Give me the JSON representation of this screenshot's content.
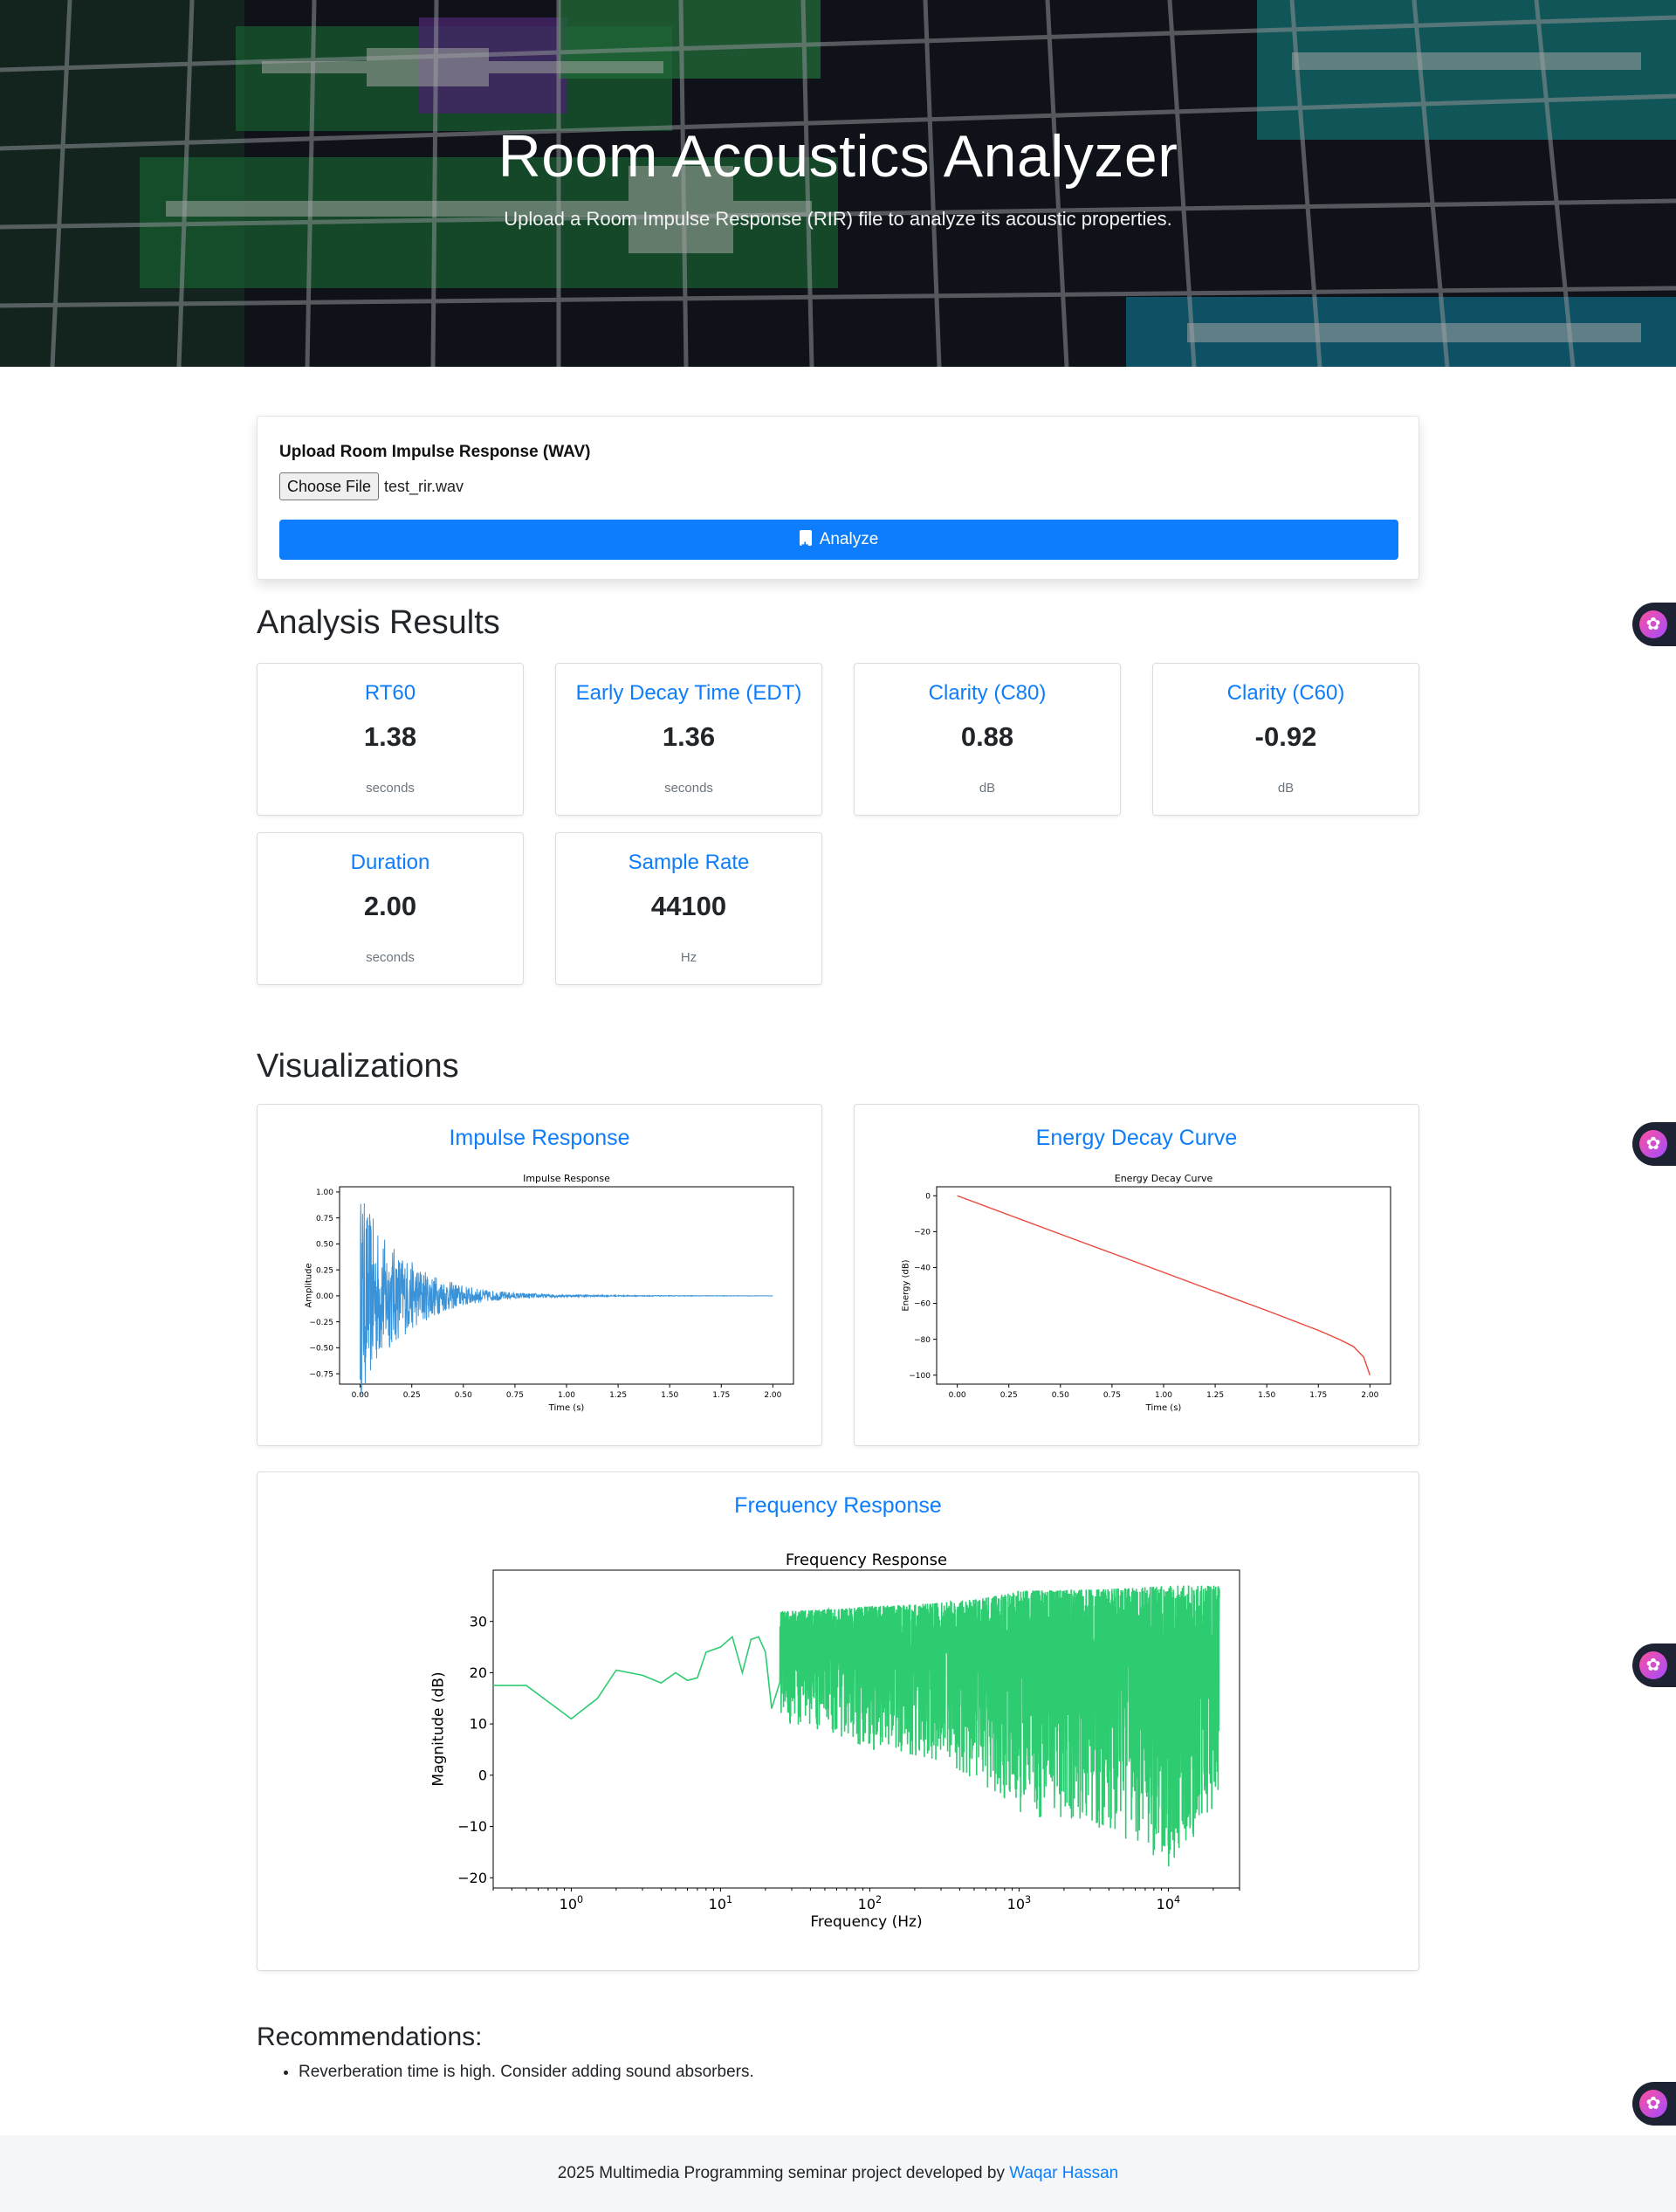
{
  "hero": {
    "title": "Room Acoustics Analyzer",
    "subtitle": "Upload a Room Impulse Response (RIR) file to analyze its acoustic properties."
  },
  "upload": {
    "label": "Upload Room Impulse Response (WAV)",
    "choose_button": "Choose File",
    "file_name": "test_rir.wav",
    "analyze_button": "Analyze",
    "analyze_icon": "file-plus-icon"
  },
  "results": {
    "heading": "Analysis Results",
    "metrics": [
      {
        "title": "RT60",
        "value": "1.38",
        "unit": "seconds"
      },
      {
        "title": "Early Decay Time (EDT)",
        "value": "1.36",
        "unit": "seconds"
      },
      {
        "title": "Clarity (C80)",
        "value": "0.88",
        "unit": "dB"
      },
      {
        "title": "Clarity (C60)",
        "value": "-0.92",
        "unit": "dB"
      },
      {
        "title": "Duration",
        "value": "2.00",
        "unit": "seconds"
      },
      {
        "title": "Sample Rate",
        "value": "44100",
        "unit": "Hz"
      }
    ]
  },
  "visualizations": {
    "heading": "Visualizations",
    "impulse_card_title": "Impulse Response",
    "edc_card_title": "Energy Decay Curve",
    "freq_card_title": "Frequency Response"
  },
  "chart_data": [
    {
      "type": "line",
      "title": "Impulse Response",
      "xlabel": "Time (s)",
      "ylabel": "Amplitude",
      "xlim": [
        0,
        2.0
      ],
      "ylim": [
        -0.85,
        1.05
      ],
      "xticks": [
        "0.00",
        "0.25",
        "0.50",
        "0.75",
        "1.00",
        "1.25",
        "1.50",
        "1.75",
        "2.00"
      ],
      "yticks": [
        "1.00",
        "0.75",
        "0.50",
        "0.25",
        "0.00",
        "−0.25",
        "−0.50",
        "−0.75"
      ],
      "envelope": {
        "x": [
          0,
          0.05,
          0.1,
          0.2,
          0.3,
          0.4,
          0.5,
          0.6,
          0.75,
          1.0,
          1.25,
          1.5,
          2.0
        ],
        "y": [
          1.0,
          0.8,
          0.6,
          0.4,
          0.26,
          0.16,
          0.1,
          0.06,
          0.03,
          0.012,
          0.006,
          0.003,
          0.001
        ]
      },
      "color": "#3a93d8",
      "grid": false
    },
    {
      "type": "line",
      "title": "Energy Decay Curve",
      "xlabel": "Time (s)",
      "ylabel": "Energy (dB)",
      "xlim": [
        0,
        2.0
      ],
      "ylim": [
        -100,
        0
      ],
      "xticks": [
        "0.00",
        "0.25",
        "0.50",
        "0.75",
        "1.00",
        "1.25",
        "1.50",
        "1.75",
        "2.00"
      ],
      "yticks": [
        "0",
        "−20",
        "−40",
        "−60",
        "−80",
        "−100"
      ],
      "x": [
        0,
        0.25,
        0.5,
        0.75,
        1.0,
        1.25,
        1.5,
        1.75,
        1.85,
        1.92,
        1.97,
        2.0
      ],
      "y": [
        0,
        -10.7,
        -21.4,
        -32,
        -42.7,
        -53.4,
        -64,
        -75,
        -80,
        -84,
        -90,
        -100
      ],
      "color": "#e8483b",
      "grid": false
    },
    {
      "type": "line",
      "title": "Frequency Response",
      "xlabel": "Frequency (Hz)",
      "ylabel": "Magnitude (dB)",
      "xscale": "log",
      "xlim": [
        0.3,
        30000
      ],
      "ylim": [
        -22,
        40
      ],
      "xticks": [
        "10^0",
        "10^1",
        "10^2",
        "10^3",
        "10^4"
      ],
      "yticks": [
        "30",
        "20",
        "10",
        "0",
        "−10",
        "−20"
      ],
      "x": [
        0.3,
        0.5,
        1,
        1.5,
        2,
        3,
        4,
        5,
        6,
        7,
        8,
        10,
        12,
        14,
        16,
        18,
        20,
        22
      ],
      "y": [
        17.5,
        17.5,
        11,
        15,
        20.5,
        19.5,
        18,
        20,
        18.5,
        19,
        24,
        25,
        27,
        20,
        26.5,
        27,
        24,
        13
      ],
      "noise_band": {
        "x": [
          25,
          100,
          1000,
          10000,
          22000
        ],
        "upper": [
          32,
          33,
          36,
          37,
          37
        ],
        "lower": [
          10,
          5,
          -8,
          -18,
          -4
        ]
      },
      "color": "#2ecc71",
      "grid": false
    }
  ],
  "recommendations": {
    "heading": "Recommendations:",
    "items": [
      "Reverberation time is high. Consider adding sound absorbers."
    ]
  },
  "footer": {
    "text": "2025 Multimedia Programming seminar project developed by ",
    "author": "Waqar Hassan"
  },
  "side_widget": {
    "icon": "brain-icon"
  }
}
